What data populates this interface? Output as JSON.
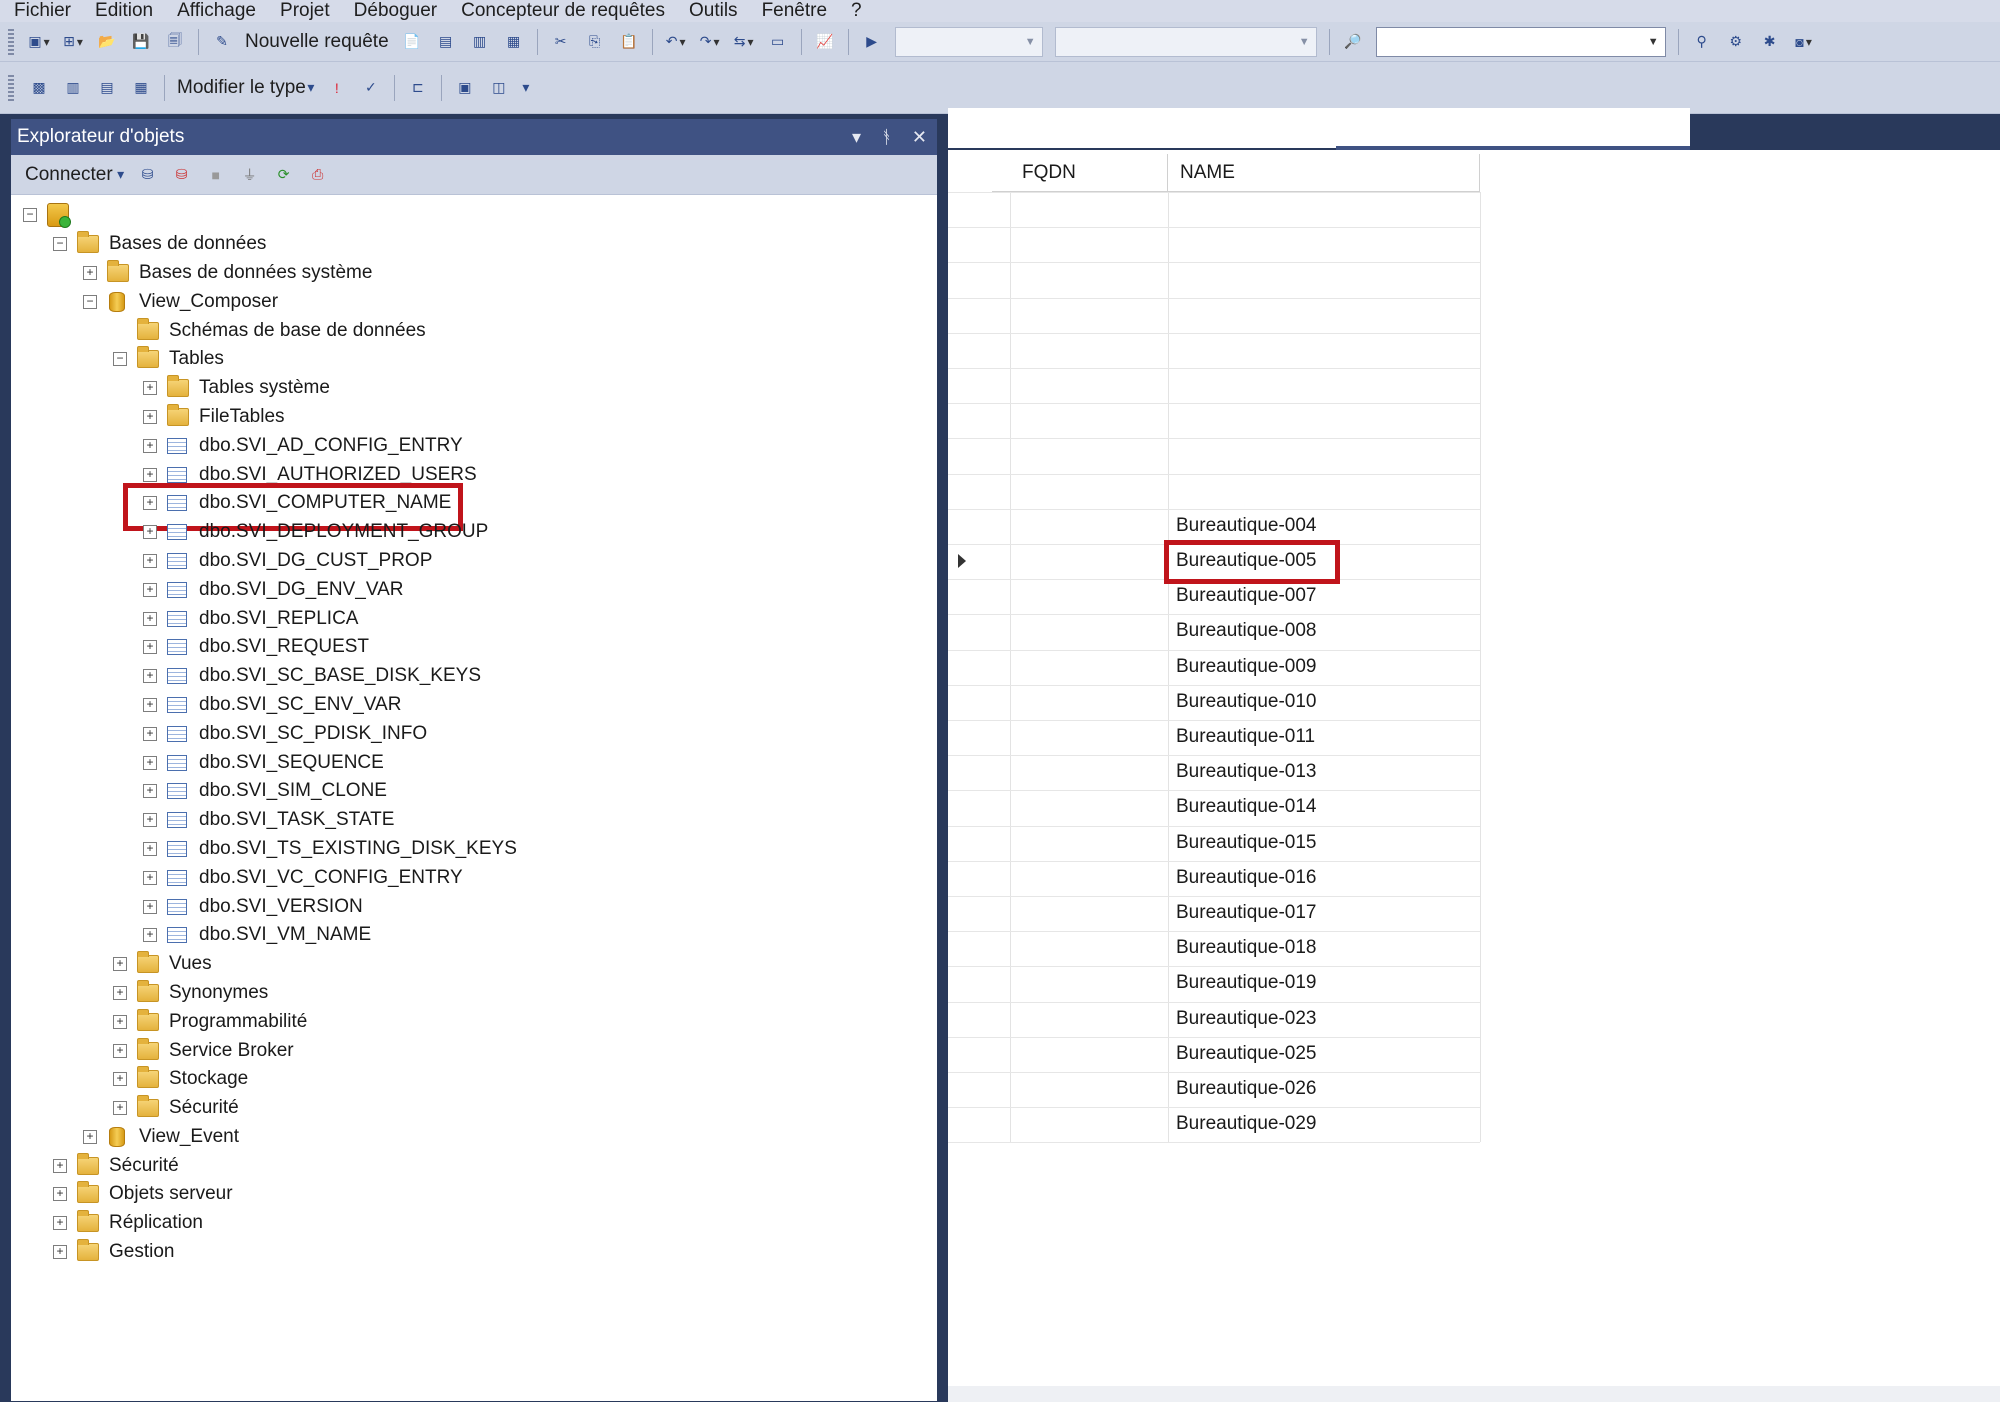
{
  "menu": [
    "Fichier",
    "Edition",
    "Affichage",
    "Projet",
    "Déboguer",
    "Concepteur de requêtes",
    "Outils",
    "Fenêtre",
    "?"
  ],
  "toolbar1": {
    "new_query": "Nouvelle requête"
  },
  "toolbar2": {
    "change_type": "Modifier le type"
  },
  "object_explorer": {
    "title": "Explorateur d'objets",
    "connect": "Connecter",
    "tree": [
      {
        "label": "",
        "depth": 0,
        "icon": "server-icon",
        "expander": "minus"
      },
      {
        "label": "Bases de données",
        "depth": 1,
        "icon": "folder-icon",
        "expander": "minus"
      },
      {
        "label": "Bases de données système",
        "depth": 2,
        "icon": "folder-icon",
        "expander": "plus"
      },
      {
        "label": "View_Composer",
        "depth": 2,
        "icon": "database-icon",
        "expander": "minus"
      },
      {
        "label": "Schémas de base de données",
        "depth": 3,
        "icon": "folder-icon",
        "expander": "none"
      },
      {
        "label": "Tables",
        "depth": 3,
        "icon": "folder-icon",
        "expander": "minus"
      },
      {
        "label": "Tables système",
        "depth": 4,
        "icon": "folder-icon",
        "expander": "plus"
      },
      {
        "label": "FileTables",
        "depth": 4,
        "icon": "folder-icon",
        "expander": "plus"
      },
      {
        "label": "dbo.SVI_AD_CONFIG_ENTRY",
        "depth": 4,
        "icon": "table-icon",
        "expander": "plus"
      },
      {
        "label": "dbo.SVI_AUTHORIZED_USERS",
        "depth": 4,
        "icon": "table-icon",
        "expander": "plus"
      },
      {
        "label": "dbo.SVI_COMPUTER_NAME",
        "depth": 4,
        "icon": "table-icon",
        "expander": "plus"
      },
      {
        "label": "dbo.SVI_DEPLOYMENT_GROUP",
        "depth": 4,
        "icon": "table-icon",
        "expander": "plus"
      },
      {
        "label": "dbo.SVI_DG_CUST_PROP",
        "depth": 4,
        "icon": "table-icon",
        "expander": "plus"
      },
      {
        "label": "dbo.SVI_DG_ENV_VAR",
        "depth": 4,
        "icon": "table-icon",
        "expander": "plus"
      },
      {
        "label": "dbo.SVI_REPLICA",
        "depth": 4,
        "icon": "table-icon",
        "expander": "plus"
      },
      {
        "label": "dbo.SVI_REQUEST",
        "depth": 4,
        "icon": "table-icon",
        "expander": "plus"
      },
      {
        "label": "dbo.SVI_SC_BASE_DISK_KEYS",
        "depth": 4,
        "icon": "table-icon",
        "expander": "plus"
      },
      {
        "label": "dbo.SVI_SC_ENV_VAR",
        "depth": 4,
        "icon": "table-icon",
        "expander": "plus"
      },
      {
        "label": "dbo.SVI_SC_PDISK_INFO",
        "depth": 4,
        "icon": "table-icon",
        "expander": "plus"
      },
      {
        "label": "dbo.SVI_SEQUENCE",
        "depth": 4,
        "icon": "table-icon",
        "expander": "plus"
      },
      {
        "label": "dbo.SVI_SIM_CLONE",
        "depth": 4,
        "icon": "table-icon",
        "expander": "plus"
      },
      {
        "label": "dbo.SVI_TASK_STATE",
        "depth": 4,
        "icon": "table-icon",
        "expander": "plus"
      },
      {
        "label": "dbo.SVI_TS_EXISTING_DISK_KEYS",
        "depth": 4,
        "icon": "table-icon",
        "expander": "plus"
      },
      {
        "label": "dbo.SVI_VC_CONFIG_ENTRY",
        "depth": 4,
        "icon": "table-icon",
        "expander": "plus"
      },
      {
        "label": "dbo.SVI_VERSION",
        "depth": 4,
        "icon": "table-icon",
        "expander": "plus"
      },
      {
        "label": "dbo.SVI_VM_NAME",
        "depth": 4,
        "icon": "table-icon",
        "expander": "plus"
      },
      {
        "label": "Vues",
        "depth": 3,
        "icon": "folder-icon",
        "expander": "plus"
      },
      {
        "label": "Synonymes",
        "depth": 3,
        "icon": "folder-icon",
        "expander": "plus"
      },
      {
        "label": "Programmabilité",
        "depth": 3,
        "icon": "folder-icon",
        "expander": "plus"
      },
      {
        "label": "Service Broker",
        "depth": 3,
        "icon": "folder-icon",
        "expander": "plus"
      },
      {
        "label": "Stockage",
        "depth": 3,
        "icon": "folder-icon",
        "expander": "plus"
      },
      {
        "label": "Sécurité",
        "depth": 3,
        "icon": "folder-icon",
        "expander": "plus"
      },
      {
        "label": "View_Event",
        "depth": 2,
        "icon": "database-icon",
        "expander": "plus"
      },
      {
        "label": "Sécurité",
        "depth": 1,
        "icon": "folder-icon",
        "expander": "plus"
      },
      {
        "label": "Objets serveur",
        "depth": 1,
        "icon": "folder-icon",
        "expander": "plus"
      },
      {
        "label": "Réplication",
        "depth": 1,
        "icon": "folder-icon",
        "expander": "plus"
      },
      {
        "label": "Gestion",
        "depth": 1,
        "icon": "folder-icon",
        "expander": "plus"
      }
    ],
    "highlighted_item": "dbo.SVI_COMPUTER_NAME"
  },
  "results": {
    "columns": [
      "FQDN",
      "NAME"
    ],
    "names": [
      "Bureautique-004",
      "Bureautique-005",
      "Bureautique-007",
      "Bureautique-008",
      "Bureautique-009",
      "Bureautique-010",
      "Bureautique-011",
      "Bureautique-013",
      "Bureautique-014",
      "Bureautique-015",
      "Bureautique-016",
      "Bureautique-017",
      "Bureautique-018",
      "Bureautique-019",
      "Bureautique-023",
      "Bureautique-025",
      "Bureautique-026",
      "Bureautique-029"
    ],
    "highlighted_name": "Bureautique-005",
    "current_row_name": "Bureautique-005"
  },
  "colors": {
    "highlight": "#c0141b",
    "panel_title": "#3f5283",
    "frame": "#29395b"
  }
}
